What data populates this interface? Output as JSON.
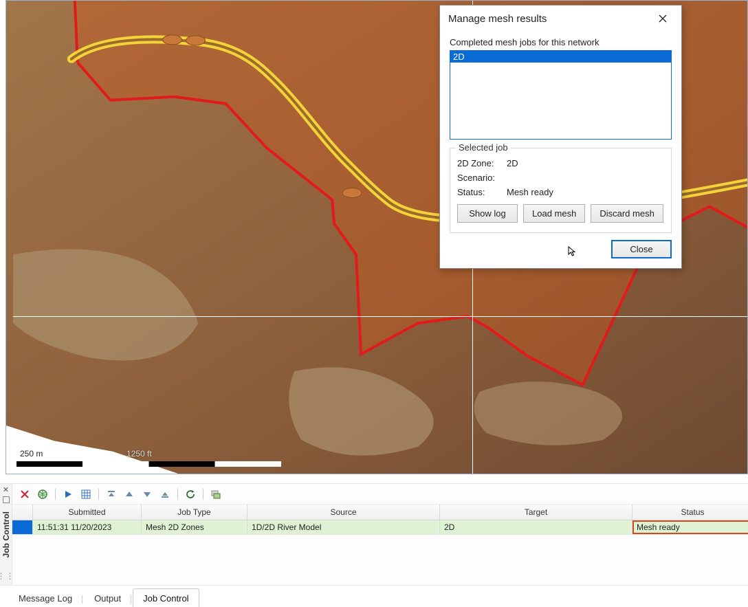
{
  "dialog": {
    "title": "Manage mesh results",
    "list_label": "Completed mesh jobs for this network",
    "list_items": [
      "2D"
    ],
    "fieldset_legend": "Selected job",
    "zone_label": "2D Zone:",
    "zone_value": "2D",
    "scenario_label": "Scenario:",
    "scenario_value": "",
    "status_label": "Status:",
    "status_value": "Mesh ready",
    "btn_show_log": "Show log",
    "btn_load_mesh": "Load mesh",
    "btn_discard_mesh": "Discard mesh",
    "btn_close": "Close"
  },
  "map": {
    "scale_left": "250 m",
    "scale_right": "1250 ft"
  },
  "job_panel": {
    "side_label": "Job Control",
    "headers": {
      "submitted": "Submitted",
      "job_type": "Job Type",
      "source": "Source",
      "target": "Target",
      "status": "Status"
    },
    "rows": [
      {
        "submitted": "11:51:31 11/20/2023",
        "job_type": "Mesh 2D Zones",
        "source": "1D/2D River Model",
        "target": "2D",
        "status": "Mesh ready"
      }
    ]
  },
  "tabs": {
    "message_log": "Message Log",
    "output": "Output",
    "job_control": "Job Control"
  },
  "colors": {
    "selection": "#0a6ad6",
    "row_bg": "#dff2d3",
    "status_highlight": "#d34a1e"
  }
}
